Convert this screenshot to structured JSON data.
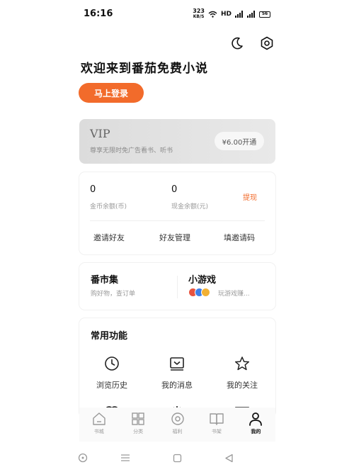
{
  "status_bar": {
    "time": "16:16",
    "net_speed_value": "323",
    "net_speed_unit": "KB/S",
    "hd_label": "HD",
    "battery": "56"
  },
  "header": {
    "welcome": "欢迎来到番茄免费小说",
    "login_label": "马上登录"
  },
  "vip": {
    "title": "VIP",
    "desc": "尊享无限时免广告看书、听书",
    "button_label": "¥6.00开通"
  },
  "wallet": {
    "coin_value": "0",
    "coin_label": "金币余额(币)",
    "cash_value": "0",
    "cash_label": "现金余额(元)",
    "withdraw_label": "提现",
    "links": [
      "邀请好友",
      "好友管理",
      "填邀请码"
    ]
  },
  "market": {
    "title": "番市集",
    "subtitle": "购好物，查订单"
  },
  "games": {
    "title": "小游戏",
    "subtitle": "玩游戏赚..."
  },
  "features": {
    "title": "常用功能",
    "items": [
      {
        "label": "浏览历史",
        "icon": "clock-icon"
      },
      {
        "label": "我的消息",
        "icon": "message-icon"
      },
      {
        "label": "我的关注",
        "icon": "star-icon"
      }
    ]
  },
  "bottom_nav": {
    "items": [
      {
        "label": "书城",
        "icon": "home-icon",
        "active": false
      },
      {
        "label": "分类",
        "icon": "grid-icon",
        "active": false
      },
      {
        "label": "福利",
        "icon": "coin-icon",
        "active": false
      },
      {
        "label": "书架",
        "icon": "book-icon",
        "active": false
      },
      {
        "label": "我的",
        "icon": "person-icon",
        "active": true
      }
    ]
  },
  "colors": {
    "accent": "#f26b2b",
    "vip_bg": "#dcdcdc"
  }
}
